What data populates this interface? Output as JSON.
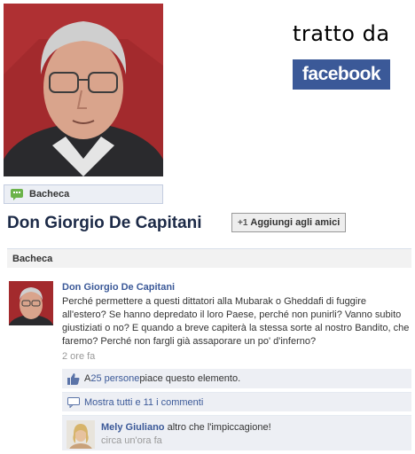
{
  "header": {
    "tratto_da": "tratto da",
    "brand_logo": "facebook"
  },
  "profile": {
    "wall_tab_label": "Bacheca",
    "name": "Don Giorgio De Capitani",
    "add_friend_label": "Aggiungi agli amici",
    "add_friend_icon": "+1"
  },
  "section": {
    "title": "Bacheca"
  },
  "post": {
    "author": "Don Giorgio De Capitani",
    "text": "Perché permettere a questi dittatori alla Mubarak o Gheddafi di fuggire all'estero? Se hanno depredato il loro Paese, perché non punirli? Vanno subito giustiziati o no? E quando a breve capiterà la stessa sorte al nostro Bandito, che faremo? Perché non fargli già assaporare un po' d'inferno?",
    "time": "2 ore fa",
    "likes_prefix": "A ",
    "likes_link": "25 persone",
    "likes_suffix": " piace questo elemento.",
    "comments_link": "Mostra tutti e 11 i commenti"
  },
  "comment": {
    "author": "Mely Giuliano",
    "text": " altro che l'impiccagione!",
    "time": "circa un'ora fa"
  },
  "colors": {
    "facebook_blue": "#3b5998",
    "photo_background": "#b03032",
    "row_background": "#edeff4"
  },
  "icons": {
    "wall_tab": "speech-bubble-icon",
    "like": "thumbs-up-icon",
    "comments": "comment-icon"
  }
}
